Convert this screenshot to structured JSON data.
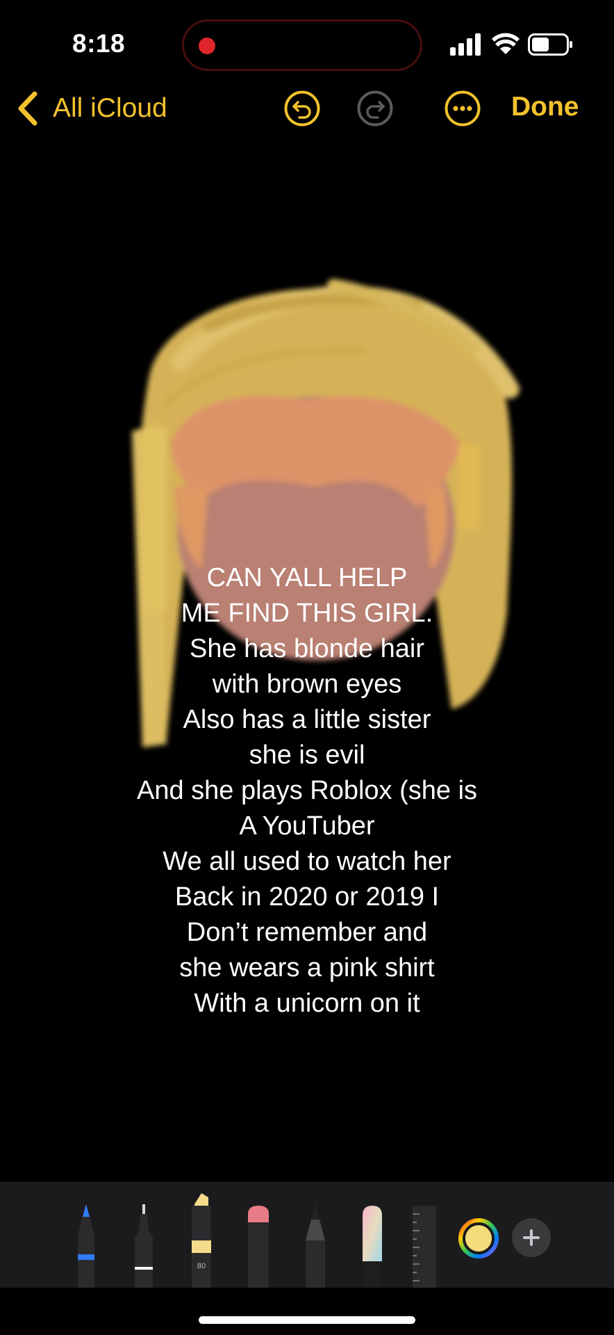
{
  "status_bar": {
    "time": "8:18",
    "recording_indicator": "red-dot",
    "icons": [
      "signal-icon",
      "wifi-icon",
      "battery-icon"
    ]
  },
  "nav": {
    "back_label": "All iCloud",
    "done_label": "Done",
    "accent": "#f3c22c",
    "undo_icon": "undo-icon",
    "redo_icon": "redo-icon",
    "more_icon": "ellipsis-icon"
  },
  "note": {
    "lines": [
      "CAN YALL HELP",
      "ME FIND THIS GIRL.",
      "She has blonde hair",
      "with brown eyes",
      "Also has a little sister",
      "she is evil",
      "And she plays Roblox (she is",
      "A YouTuber",
      "We all used to watch her",
      "Back in 2020 or 2019 I",
      "Don’t remember and",
      "she wears a pink shirt",
      "With a unicorn on it"
    ]
  },
  "drawing": {
    "hair_color": "#e8c25e",
    "face_color": "#c98b7d",
    "bangs_color": "#f0a071"
  },
  "tools": {
    "marker_label": "80",
    "items": [
      "pen",
      "monoline",
      "marker",
      "eraser",
      "pencil",
      "crayon",
      "ruler"
    ],
    "ink_blue": "#2f7cf6",
    "marker_yellow": "#f5dc8a",
    "eraser_pink": "#e87c86"
  }
}
